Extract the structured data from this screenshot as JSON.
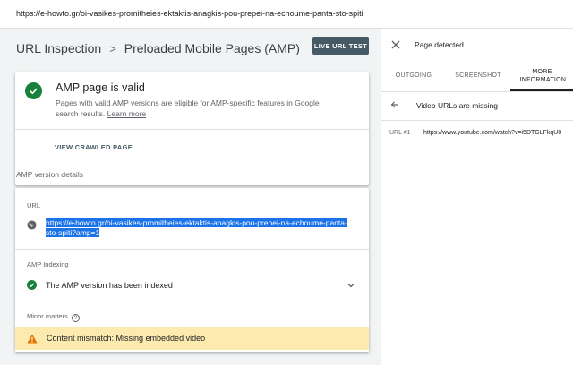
{
  "address_bar": {
    "url": "https://e-howto.gr/oi-vasikes-promitheies-ektaktis-anagkis-pou-prepei-na-echoume-panta-sto-spiti"
  },
  "breadcrumb": {
    "item1": "URL Inspection",
    "separator": ">",
    "item2": "Preloaded Mobile Pages (AMP)"
  },
  "header": {
    "live_test_label": "LIVE URL TEST"
  },
  "status_card": {
    "title": "AMP page is valid",
    "description": "Pages with valid AMP versions are eligible for AMP-specific features in Google search results.",
    "learn_more": "Learn more",
    "view_crawled": "VIEW CRAWLED PAGE"
  },
  "details": {
    "section_label": "AMP version details",
    "url_label": "URL",
    "url_value": "https://e-howto.gr/oi-vasikes-promitheies-ektaktis-anagkis-pou-prepei-na-echoume-panta-sto-spiti?amp=1",
    "indexing_label": "AMP Indexing",
    "indexing_status": "The AMP version has been indexed",
    "minor_label": "Minor matters",
    "minor_help": "?",
    "warning_text": "Content mismatch: Missing embedded video"
  },
  "panel": {
    "title": "Page detected",
    "tabs": [
      {
        "label": "OUTGOING"
      },
      {
        "label": "SCREENSHOT"
      },
      {
        "label": "MORE INFORMATION",
        "selected": true
      }
    ],
    "subheader": "Video URLs are missing",
    "row_label": "URL #1",
    "row_value": "https://www.youtube.com/watch?v=i5DTGLFkqU0"
  },
  "colors": {
    "valid_green": "#188038",
    "button_dark": "#455a64",
    "warning_bg": "#fdeaaf",
    "selection_blue": "#1a73e8"
  },
  "icons": [
    "check-circle-icon",
    "globe-icon",
    "chevron-down-icon",
    "help-icon",
    "warning-icon",
    "close-icon",
    "arrow-back-icon"
  ]
}
